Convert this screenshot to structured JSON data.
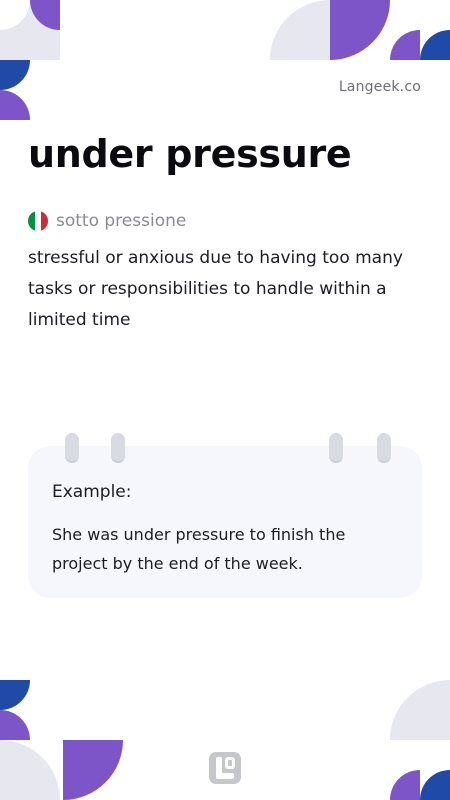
{
  "site": "Langeek.co",
  "term": "under pressure",
  "translation": {
    "language_flag": "italy-flag",
    "text": "sotto pressione",
    "flag_colors": [
      "#009246",
      "#ffffff",
      "#ce2b37"
    ]
  },
  "definition": "stressful or anxious due to having too many tasks or responsibilities to handle within a limited time",
  "example": {
    "label": "Example:",
    "text": "She was under pressure to finish the project by the end of the week."
  },
  "colors": {
    "purple": "#7e55c8",
    "blue": "#1f4aa8",
    "light_gray": "#e6e7ef"
  },
  "logo_icon": "langeek-logo-icon"
}
